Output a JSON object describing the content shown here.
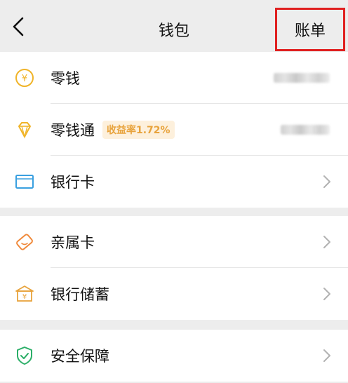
{
  "header": {
    "title": "钱包",
    "bill_label": "账单"
  },
  "section1": {
    "items": [
      {
        "label": "零钱"
      },
      {
        "label": "零钱通",
        "badge": "收益率1.72%"
      },
      {
        "label": "银行卡"
      }
    ]
  },
  "section2": {
    "items": [
      {
        "label": "亲属卡"
      },
      {
        "label": "银行储蓄"
      }
    ]
  },
  "section3": {
    "items": [
      {
        "label": "安全保障"
      }
    ]
  },
  "colors": {
    "accent_gold": "#f0b429",
    "card_blue": "#3aa0e0",
    "family_orange": "#f08a3c",
    "shield_green": "#2aae67",
    "highlight_red": "#e02020"
  }
}
